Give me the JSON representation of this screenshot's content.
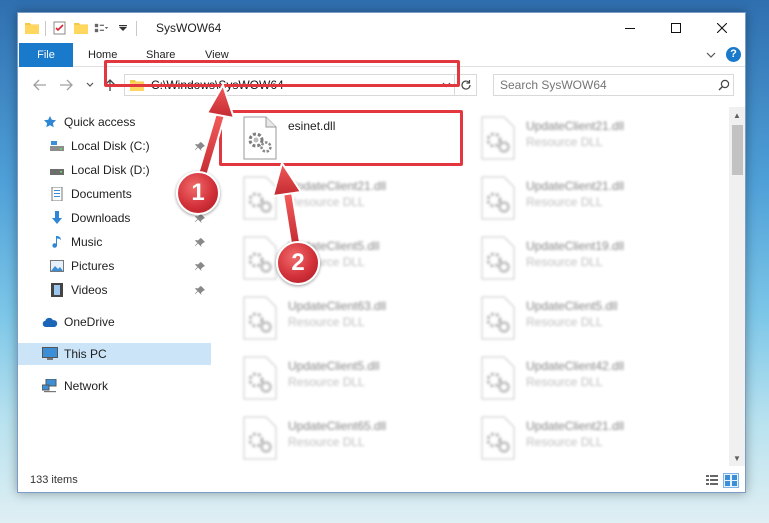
{
  "window": {
    "title": "SysWOW64"
  },
  "ribbon": {
    "tabs": [
      "File",
      "Home",
      "Share",
      "View"
    ]
  },
  "address": {
    "path": "C:\\Windows\\SysWOW64"
  },
  "search": {
    "placeholder": "Search SysWOW64"
  },
  "nav": {
    "items": [
      {
        "label": "Quick access",
        "icon": "star-icon",
        "pinned": false
      },
      {
        "label": "Local Disk (C:)",
        "icon": "drive-icon",
        "pinned": true
      },
      {
        "label": "Local Disk (D:)",
        "icon": "drive-icon",
        "pinned": false
      },
      {
        "label": "Documents",
        "icon": "documents-icon",
        "pinned": true
      },
      {
        "label": "Downloads",
        "icon": "downloads-icon",
        "pinned": true
      },
      {
        "label": "Music",
        "icon": "music-icon",
        "pinned": true
      },
      {
        "label": "Pictures",
        "icon": "pictures-icon",
        "pinned": true
      },
      {
        "label": "Videos",
        "icon": "videos-icon",
        "pinned": true
      },
      {
        "label": "OneDrive",
        "icon": "onedrive-icon",
        "pinned": false
      },
      {
        "label": "This PC",
        "icon": "computer-icon",
        "pinned": false,
        "selected": true
      },
      {
        "label": "Network",
        "icon": "network-icon",
        "pinned": false
      }
    ]
  },
  "files": {
    "col1": [
      {
        "name": "esinet.dll",
        "type": ""
      },
      {
        "name": "UpdateClient21.dll",
        "type": "Resource DLL"
      },
      {
        "name": "UpdateClient5.dll",
        "type": "Resource DLL"
      },
      {
        "name": "UpdateClient63.dll",
        "type": "Resource DLL"
      },
      {
        "name": "UpdateClient5.dll",
        "type": "Resource DLL"
      },
      {
        "name": "UpdateClient65.dll",
        "type": "Resource DLL"
      }
    ],
    "col2": [
      {
        "name": "UpdateClient21.dll",
        "type": "Resource DLL"
      },
      {
        "name": "UpdateClient21.dll",
        "type": "Resource DLL"
      },
      {
        "name": "UpdateClient19.dll",
        "type": "Resource DLL"
      },
      {
        "name": "UpdateClient5.dll",
        "type": "Resource DLL"
      },
      {
        "name": "UpdateClient42.dll",
        "type": "Resource DLL"
      },
      {
        "name": "UpdateClient21.dll",
        "type": "Resource DLL"
      }
    ]
  },
  "status": {
    "count": "133 items"
  },
  "annotations": {
    "step1": "1",
    "step2": "2"
  },
  "colors": {
    "accent": "#1979ca",
    "highlight": "#e2373f",
    "selected": "#cce4f7"
  }
}
